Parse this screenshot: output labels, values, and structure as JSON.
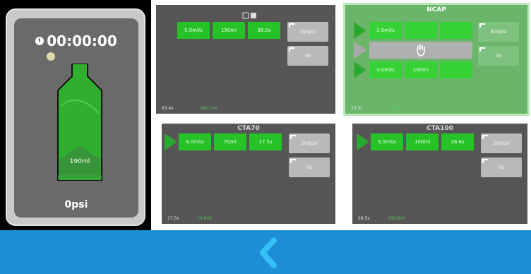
{
  "status_panel": {
    "timer": "00:00:00",
    "volume": "190ml",
    "volume_sub": "",
    "pressure": "0psi"
  },
  "protocols": [
    {
      "title": "",
      "phase1": {
        "rate": "5.0ml/s",
        "volume": "190ml",
        "duration": "38.0s"
      },
      "pressure_btn": "300psi",
      "delay_btn": "0s",
      "footer_time": "63.4s",
      "footer_vol": "190.1ml"
    },
    {
      "title": "NCAP",
      "phase1": {
        "rate": "3.0ml/s",
        "volume": "",
        "duration": ""
      },
      "phase2": {
        "rate": "3.0ml/s",
        "volume": "100ml",
        "duration": ""
      },
      "pressure_btn": "300psi",
      "delay_btn": "0s",
      "footer_time": "33.3s",
      "footer_vol": "100ml"
    },
    {
      "title": "CTA70",
      "phase1": {
        "rate": "4.0ml/s",
        "volume": "70ml",
        "duration": "17.5s"
      },
      "pressure_btn": "300psi",
      "delay_btn": "0s",
      "footer_time": "17.5s",
      "footer_vol": "70.0ml"
    },
    {
      "title": "CTA100",
      "phase1": {
        "rate": "3.5ml/s",
        "volume": "100ml",
        "duration": "28.6s"
      },
      "pressure_btn": "300psi",
      "delay_btn": "0s",
      "footer_time": "28.5s",
      "footer_vol": "100.0ml"
    }
  ],
  "colors": {
    "accent_blue": "#1e8ed6",
    "phase_green": "#27c227",
    "panel_gray": "#565656",
    "active_green": "#6bb56b"
  },
  "icons": [
    "timer-icon",
    "syringe-icon",
    "hand-icon",
    "back-chevron-icon"
  ]
}
